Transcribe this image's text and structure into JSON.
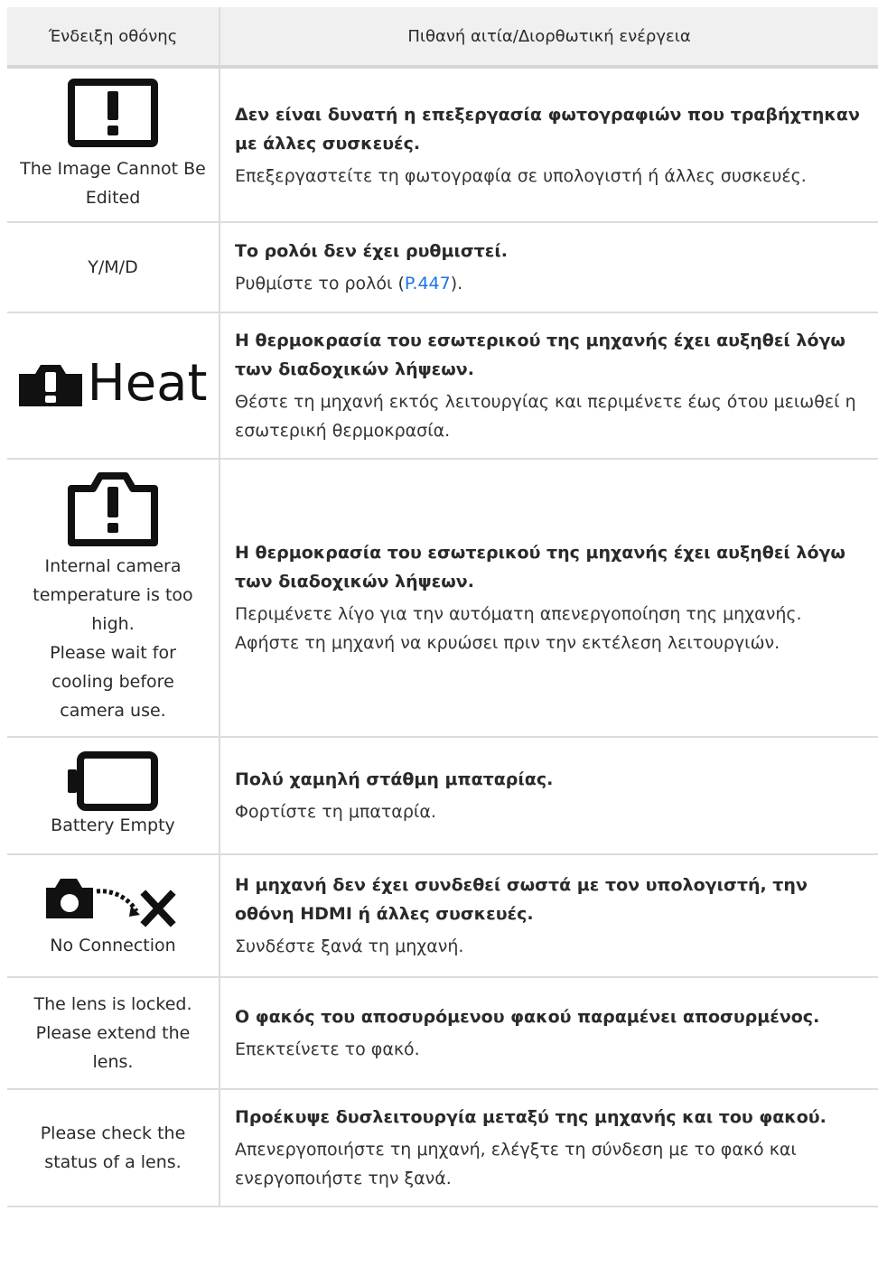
{
  "header": {
    "col1": "Ένδειξη οθόνης",
    "col2": "Πιθανή αιτία/Διορθωτική ενέργεια"
  },
  "rows": [
    {
      "icon": "warning-screen-icon",
      "display": "The Image Cannot Be Edited",
      "cause": "Δεν είναι δυνατή η επεξεργασία φωτογραφιών που τραβήχτηκαν με άλλες συσκευές.",
      "action": "Επεξεργαστείτε τη φωτογραφία σε υπολογιστή ή άλλες συσκευές."
    },
    {
      "display": "Y/M/D",
      "cause": "Το ρολόι δεν έχει ρυθμιστεί.",
      "action_pre": "Ρυθμίστε το ρολόι (",
      "action_link": "P.447",
      "action_post": ")."
    },
    {
      "icon": "heat-warning-icon",
      "display": "Heat",
      "cause": "Η θερμοκρασία του εσωτερικού της μηχανής έχει αυξηθεί λόγω των διαδοχικών λήψεων.",
      "action": "Θέστε τη μηχανή εκτός λειτουργίας και περιμένετε έως ότου μειωθεί η εσωτερική θερμοκρασία."
    },
    {
      "icon": "camera-warning-icon",
      "display_lines": [
        "Internal camera",
        "temperature is too",
        "high.",
        "Please wait for",
        "cooling before",
        "camera use."
      ],
      "cause": "Η θερμοκρασία του εσωτερικού της μηχανής έχει αυξηθεί λόγω των διαδοχικών λήψεων.",
      "action_lines": [
        "Περιμένετε λίγο για την αυτόματη απενεργοποίηση της μηχανής.",
        "Αφήστε τη μηχανή να κρυώσει πριν την εκτέλεση λειτουργιών."
      ]
    },
    {
      "icon": "battery-empty-icon",
      "display": "Battery Empty",
      "cause": "Πολύ χαμηλή στάθμη μπαταρίας.",
      "action": "Φορτίστε τη μπαταρία."
    },
    {
      "icon": "no-connection-icon",
      "display": "No Connection",
      "cause": "Η μηχανή δεν έχει συνδεθεί σωστά με τον υπολογιστή, την οθόνη HDMI ή άλλες συσκευές.",
      "action": "Συνδέστε ξανά τη μηχανή."
    },
    {
      "display_lines": [
        "The lens is locked.",
        "Please extend the",
        "lens."
      ],
      "cause": "Ο φακός του αποσυρόμενου φακού παραμένει αποσυρμένος.",
      "action": "Επεκτείνετε το φακό."
    },
    {
      "display_lines": [
        "Please check the",
        "status of a lens."
      ],
      "cause": "Προέκυψε δυσλειτουργία μεταξύ της μηχανής και του φακού.",
      "action": "Απενεργοποιήστε τη μηχανή, ελέγξτε τη σύνδεση με το φακό και ενεργοποιήστε την ξανά."
    }
  ]
}
